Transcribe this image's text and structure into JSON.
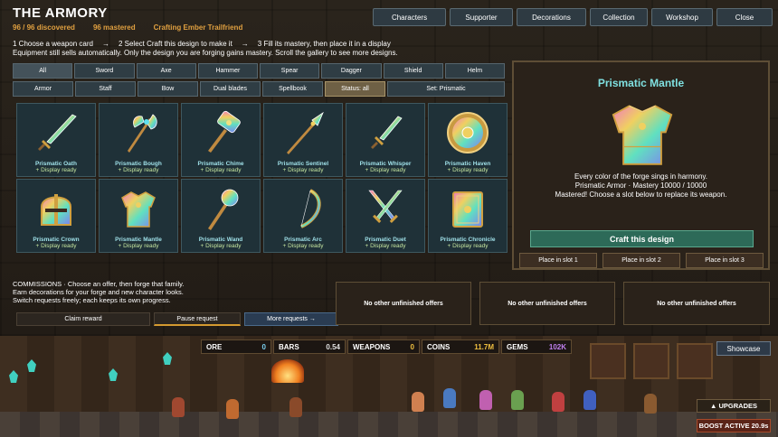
{
  "header": {
    "title": "THE ARMORY",
    "discovered": "96 / 96 discovered",
    "mastered": "96 mastered",
    "crafting": "Crafting Ember Trailfriend"
  },
  "nav": {
    "characters": "Characters",
    "supporter": "Supporter",
    "decorations": "Decorations",
    "collection": "Collection",
    "workshop": "Workshop",
    "close": "Close"
  },
  "steps": {
    "s1": "1  Choose a weapon card",
    "arrow": "→",
    "s2": "2  Select Craft this design to make it",
    "s3": "3  Fill its mastery, then place it in a display",
    "note": "Equipment still sells automatically. Only the design you are forging gains mastery. Scroll the gallery to see more designs."
  },
  "filters": {
    "row1": [
      "All",
      "Sword",
      "Axe",
      "Hammer",
      "Spear",
      "Dagger",
      "Shield",
      "Helm"
    ],
    "row2": [
      "Armor",
      "Staff",
      "Bow",
      "Dual blades",
      "Spellbook",
      "Status: all",
      "Set: Prismatic"
    ]
  },
  "cards": [
    {
      "name": "Prismatic Oath",
      "status": "+ Display ready",
      "icon": "sword-icon"
    },
    {
      "name": "Prismatic Bough",
      "status": "+ Display ready",
      "icon": "axe-icon"
    },
    {
      "name": "Prismatic Chime",
      "status": "+ Display ready",
      "icon": "hammer-icon"
    },
    {
      "name": "Prismatic Sentinel",
      "status": "+ Display ready",
      "icon": "spear-icon"
    },
    {
      "name": "Prismatic Whisper",
      "status": "+ Display ready",
      "icon": "dagger-icon"
    },
    {
      "name": "Prismatic Haven",
      "status": "+ Display ready",
      "icon": "shield-icon"
    },
    {
      "name": "Prismatic Crown",
      "status": "+ Display ready",
      "icon": "helm-icon"
    },
    {
      "name": "Prismatic Mantle",
      "status": "+ Display ready",
      "icon": "armor-icon"
    },
    {
      "name": "Prismatic Wand",
      "status": "+ Display ready",
      "icon": "staff-icon"
    },
    {
      "name": "Prismatic Arc",
      "status": "+ Display ready",
      "icon": "bow-icon"
    },
    {
      "name": "Prismatic Duet",
      "status": "+ Display ready",
      "icon": "dual-blades-icon"
    },
    {
      "name": "Prismatic Chronicle",
      "status": "+ Display ready",
      "icon": "spellbook-icon"
    }
  ],
  "detail": {
    "title": "Prismatic Mantle",
    "line1": "Every color of the forge sings in harmony.",
    "line2": "Prismatic Armor · Mastery 10000 / 10000",
    "line3": "Mastered! Choose a slot below to replace its weapon.",
    "craft": "Craft this design",
    "slot1": "Place in slot 1",
    "slot2": "Place in slot 2",
    "slot3": "Place in slot 3"
  },
  "commissions": {
    "line1": "COMMISSIONS · Choose an offer, then forge that family.",
    "line2": "Earn decorations for your forge and new character looks.",
    "line3": "Switch requests freely; each keeps its own progress.",
    "claim": "Claim reward",
    "pause": "Pause request",
    "more": "More requests →",
    "offer1": "No other unfinished offers",
    "offer2": "No other unfinished offers",
    "offer3": "No other unfinished offers"
  },
  "hud": {
    "ore_label": "ORE",
    "ore": "0",
    "bars_label": "BARS",
    "bars": "0.54",
    "weapons_label": "WEAPONS",
    "weapons": "0",
    "coins_label": "COINS",
    "coins": "11.7M",
    "gems_label": "GEMS",
    "gems": "102K",
    "showcase": "Showcase",
    "upgrades": "▲ UPGRADES",
    "boost": "BOOST ACTIVE  20.9s"
  },
  "colors": {
    "accent": "#7fe0e0",
    "gold": "#e0a040",
    "gems": "#c080f0"
  }
}
